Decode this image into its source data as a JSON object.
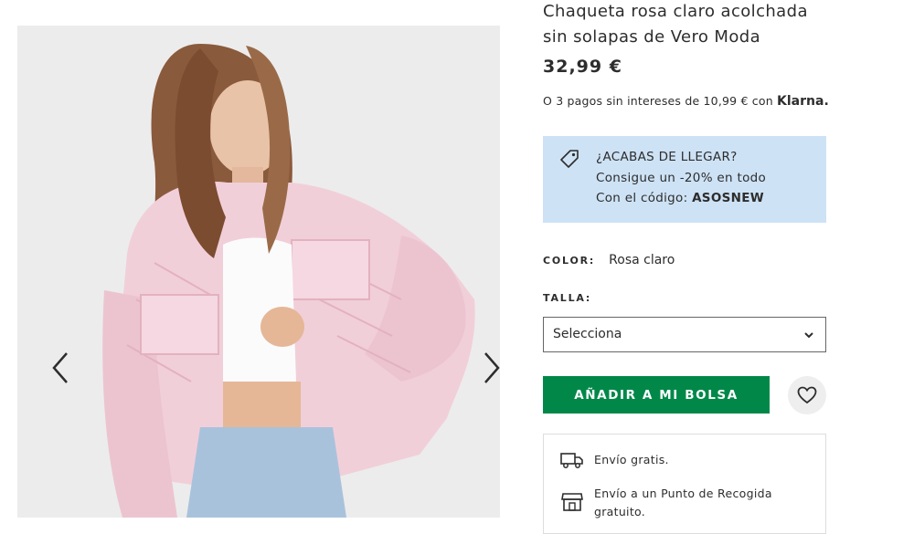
{
  "product": {
    "title_line1": "Chaqueta rosa claro acolchada",
    "title_line2": "sin solapas de Vero Moda",
    "price": "32,99 €",
    "installments": "O 3 pagos sin intereses de 10,99 € con",
    "installments_provider": "Klarna."
  },
  "promo": {
    "line1": "¿ACABAS DE LLEGAR?",
    "line2": "Consigue un -20% en todo",
    "line3_prefix": "Con el código:",
    "code": "ASOSNEW",
    "background": "#cde2f5"
  },
  "color": {
    "label": "COLOR:",
    "value": "Rosa claro"
  },
  "size": {
    "label": "TALLA:",
    "selected": "Selecciona"
  },
  "actions": {
    "add_to_bag": "AÑADIR A MI BOLSA",
    "button_color": "#018849"
  },
  "delivery": [
    {
      "icon": "truck-icon",
      "text": "Envío gratis."
    },
    {
      "icon": "store-icon",
      "line1": "Envío a un Punto de Recogida",
      "line2": "gratuito."
    }
  ],
  "gallery": {
    "icons": [
      "chevron-left-icon",
      "chevron-right-icon"
    ]
  }
}
